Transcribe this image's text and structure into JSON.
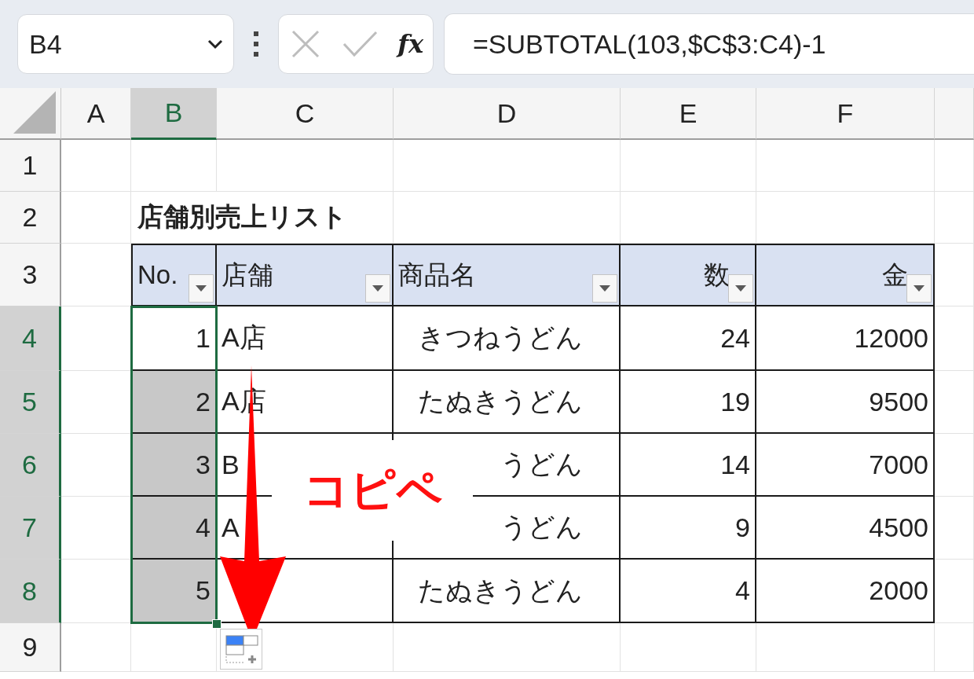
{
  "name_box": {
    "value": "B4"
  },
  "formula_bar": {
    "fx": "fx",
    "formula": "=SUBTOTAL(103,$C$3:C4)-1"
  },
  "columns": [
    {
      "label": "A",
      "selected": false
    },
    {
      "label": "B",
      "selected": true
    },
    {
      "label": "C",
      "selected": false
    },
    {
      "label": "D",
      "selected": false
    },
    {
      "label": "E",
      "selected": false
    },
    {
      "label": "F",
      "selected": false
    }
  ],
  "rows": [
    {
      "label": "1",
      "selected": false
    },
    {
      "label": "2",
      "selected": false
    },
    {
      "label": "3",
      "selected": false
    },
    {
      "label": "4",
      "selected": true
    },
    {
      "label": "5",
      "selected": true
    },
    {
      "label": "6",
      "selected": true
    },
    {
      "label": "7",
      "selected": true
    },
    {
      "label": "8",
      "selected": true
    },
    {
      "label": "9",
      "selected": false
    }
  ],
  "title": "店舗別売上リスト",
  "table": {
    "columns": [
      {
        "label": "No.",
        "kind": "index"
      },
      {
        "label": "店舗",
        "kind": "text"
      },
      {
        "label": "商品名",
        "kind": "text"
      },
      {
        "label": "数",
        "kind": "number"
      },
      {
        "label": "金",
        "kind": "number"
      }
    ],
    "rows": [
      {
        "active": true,
        "cells": [
          "1",
          "A店",
          "きつねうどん",
          "24",
          "12000"
        ]
      },
      {
        "active": false,
        "cells": [
          "2",
          "A店",
          "たぬきうどん",
          "19",
          "9500"
        ]
      },
      {
        "active": false,
        "cells": [
          "3",
          "B",
          "うどん",
          "14",
          "7000"
        ]
      },
      {
        "active": false,
        "cells": [
          "4",
          "A",
          "うどん",
          "9",
          "4500"
        ]
      },
      {
        "active": false,
        "cells": [
          "5",
          null,
          "たぬきうどん",
          "4",
          "2000"
        ]
      }
    ]
  },
  "annotation": {
    "text": "コピペ"
  }
}
